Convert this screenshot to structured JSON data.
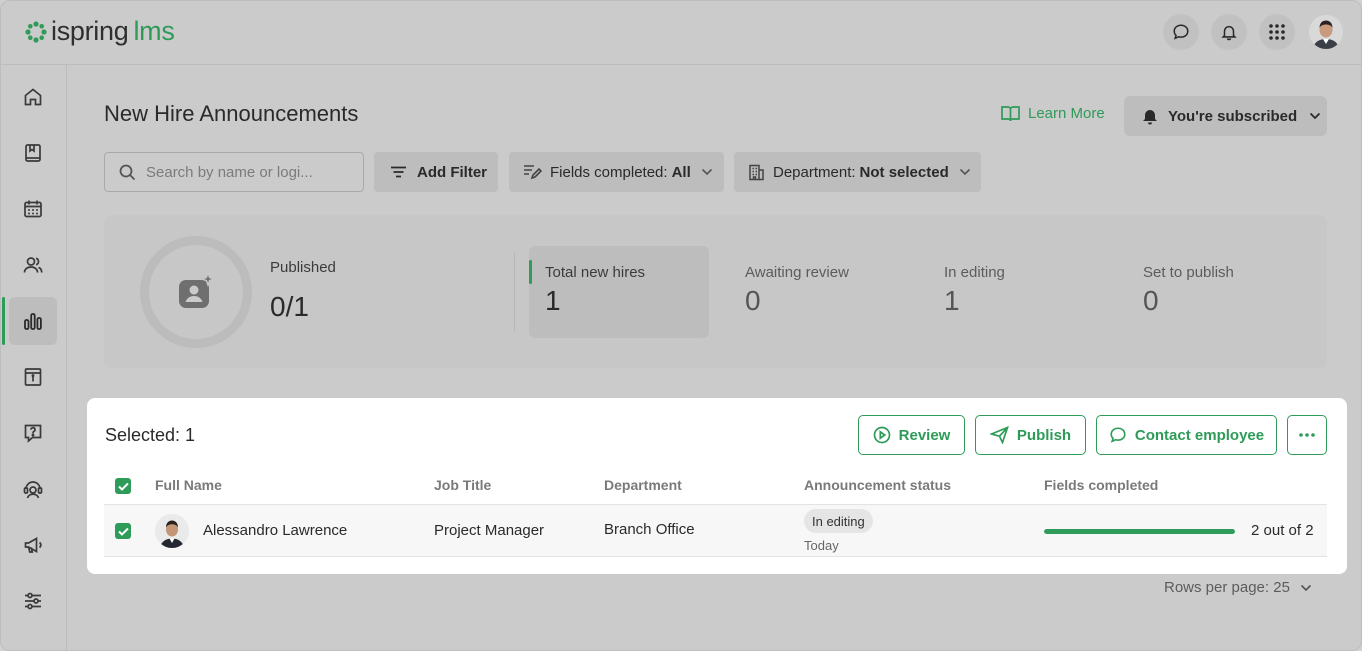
{
  "app": {
    "logo_main": "ispring",
    "logo_accent": "lms"
  },
  "topbar": {
    "icons": [
      "chat-icon",
      "bell-icon",
      "apps-grid-icon",
      "user-avatar"
    ]
  },
  "sidebar": {
    "items": [
      {
        "icon": "home-icon"
      },
      {
        "icon": "book-icon"
      },
      {
        "icon": "calendar-icon"
      },
      {
        "icon": "users-icon"
      },
      {
        "icon": "reports-icon",
        "active": true
      },
      {
        "icon": "info-board-icon"
      },
      {
        "icon": "question-icon"
      },
      {
        "icon": "support-agent-icon"
      },
      {
        "icon": "megaphone-icon"
      },
      {
        "icon": "settings-sliders-icon"
      }
    ]
  },
  "header": {
    "title": "New Hire Announcements",
    "learn_more": "Learn More",
    "subscribed": "You're subscribed"
  },
  "filters": {
    "search_placeholder": "Search by name or logi...",
    "add_filter": "Add Filter",
    "fields_label": "Fields completed:",
    "fields_value": "All",
    "department_label": "Department:",
    "department_value": "Not selected"
  },
  "stats": {
    "published_label": "Published",
    "published_value": "0/1",
    "items": [
      {
        "label": "Total new hires",
        "value": "1"
      },
      {
        "label": "Awaiting review",
        "value": "0"
      },
      {
        "label": "In editing",
        "value": "1"
      },
      {
        "label": "Set to publish",
        "value": "0"
      }
    ]
  },
  "selection": {
    "label": "Selected: 1",
    "review": "Review",
    "publish": "Publish",
    "contact": "Contact employee"
  },
  "table": {
    "headers": [
      "Full Name",
      "Job Title",
      "Department",
      "Announcement status",
      "Fields completed"
    ],
    "rows": [
      {
        "name": "Alessandro Lawrence",
        "job_title": "Project Manager",
        "department": "Branch Office",
        "status": "In editing",
        "status_date": "Today",
        "fields_fraction": 1.0,
        "fields_text": "2 out of 2"
      }
    ]
  },
  "pagination": {
    "rows_per_page": "Rows per page: 25"
  },
  "colors": {
    "accent": "#2e9b58"
  }
}
